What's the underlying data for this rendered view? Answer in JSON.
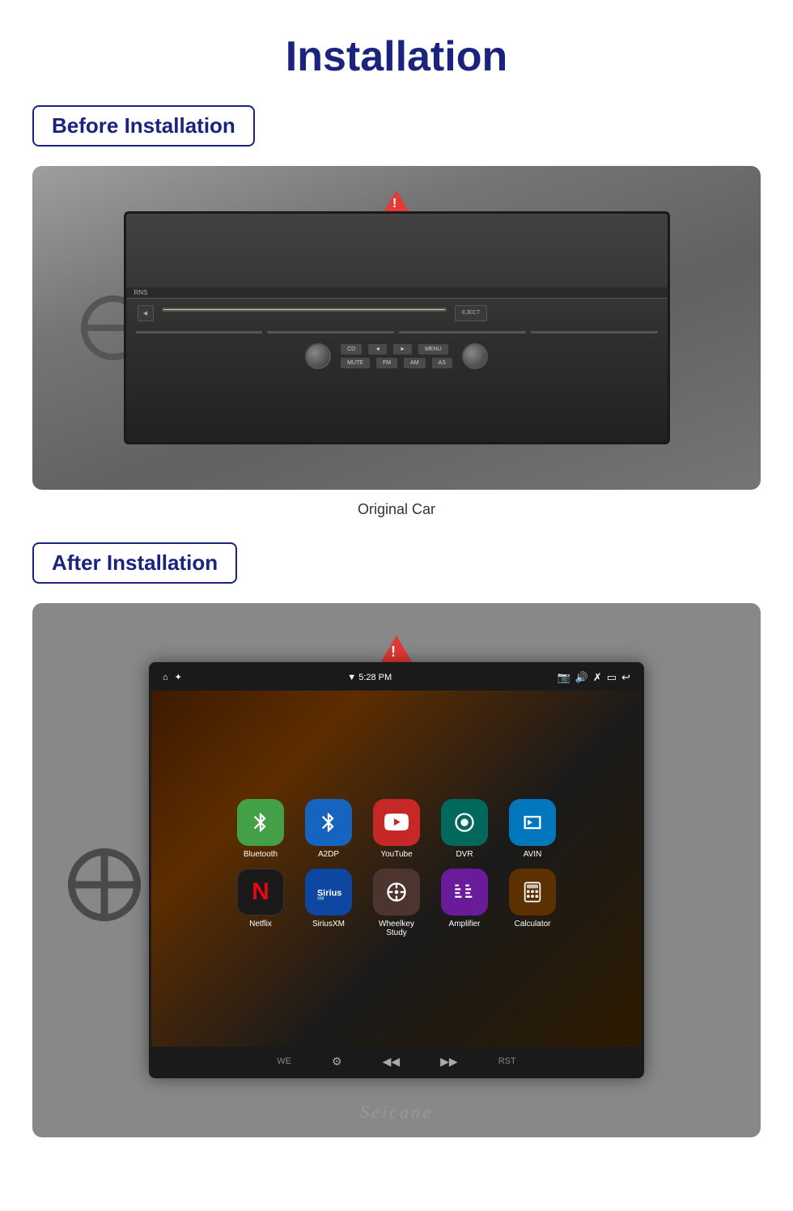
{
  "page": {
    "title": "Installation",
    "before_label": "Before Installation",
    "after_label": "After Installation",
    "caption": "Original Car",
    "brand": "Seicane"
  },
  "status_bar": {
    "signal": "▼",
    "time": "5:28 PM",
    "icons": [
      "📷",
      "🔊",
      "✗",
      "▭",
      "↩"
    ]
  },
  "apps_row1": [
    {
      "label": "Bluetooth",
      "bg": "green",
      "icon": "🔵"
    },
    {
      "label": "A2DP",
      "bg": "blue",
      "icon": "🔷"
    },
    {
      "label": "YouTube",
      "bg": "red",
      "icon": "▶"
    },
    {
      "label": "DVR",
      "bg": "purple",
      "icon": "⊙"
    },
    {
      "label": "AVIN",
      "bg": "teal",
      "icon": "⬚"
    }
  ],
  "apps_row2": [
    {
      "label": "Netflix",
      "bg": "netflix",
      "icon": "N"
    },
    {
      "label": "SiriusXM",
      "bg": "sirius",
      "icon": "S"
    },
    {
      "label": "Wheelkey Study",
      "bg": "wheelkey",
      "icon": "⊕"
    },
    {
      "label": "Amplifier",
      "bg": "amplifier",
      "icon": "▦"
    },
    {
      "label": "Calculator",
      "bg": "calculator",
      "icon": "▤"
    }
  ],
  "nav_bar": {
    "icons": [
      "we",
      "⚙",
      "◀◀",
      "▶▶",
      "RST"
    ]
  }
}
